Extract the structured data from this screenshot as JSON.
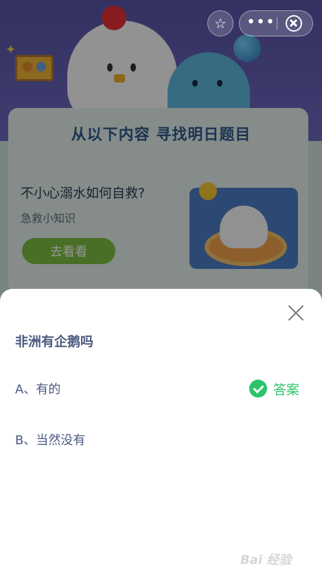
{
  "banner": {
    "title": "从以下内容 寻找明日题目"
  },
  "card": {
    "title": "不小心溺水如何自救?",
    "subtitle": "急救小知识",
    "button_label": "去看看"
  },
  "capsule": {
    "favorite_icon": "star-icon",
    "more_icon": "more-dots-icon",
    "more_glyph": "•••",
    "close_icon": "close-circle-icon"
  },
  "sheet": {
    "question": "非洲有企鹅吗",
    "options": [
      {
        "label": "A、有的",
        "is_answer": true
      },
      {
        "label": "B、当然没有",
        "is_answer": false
      }
    ],
    "answer_label": "答案",
    "accent_color": "#2cc36b",
    "text_color": "#4a5a80"
  },
  "watermark": "Bai 经验"
}
